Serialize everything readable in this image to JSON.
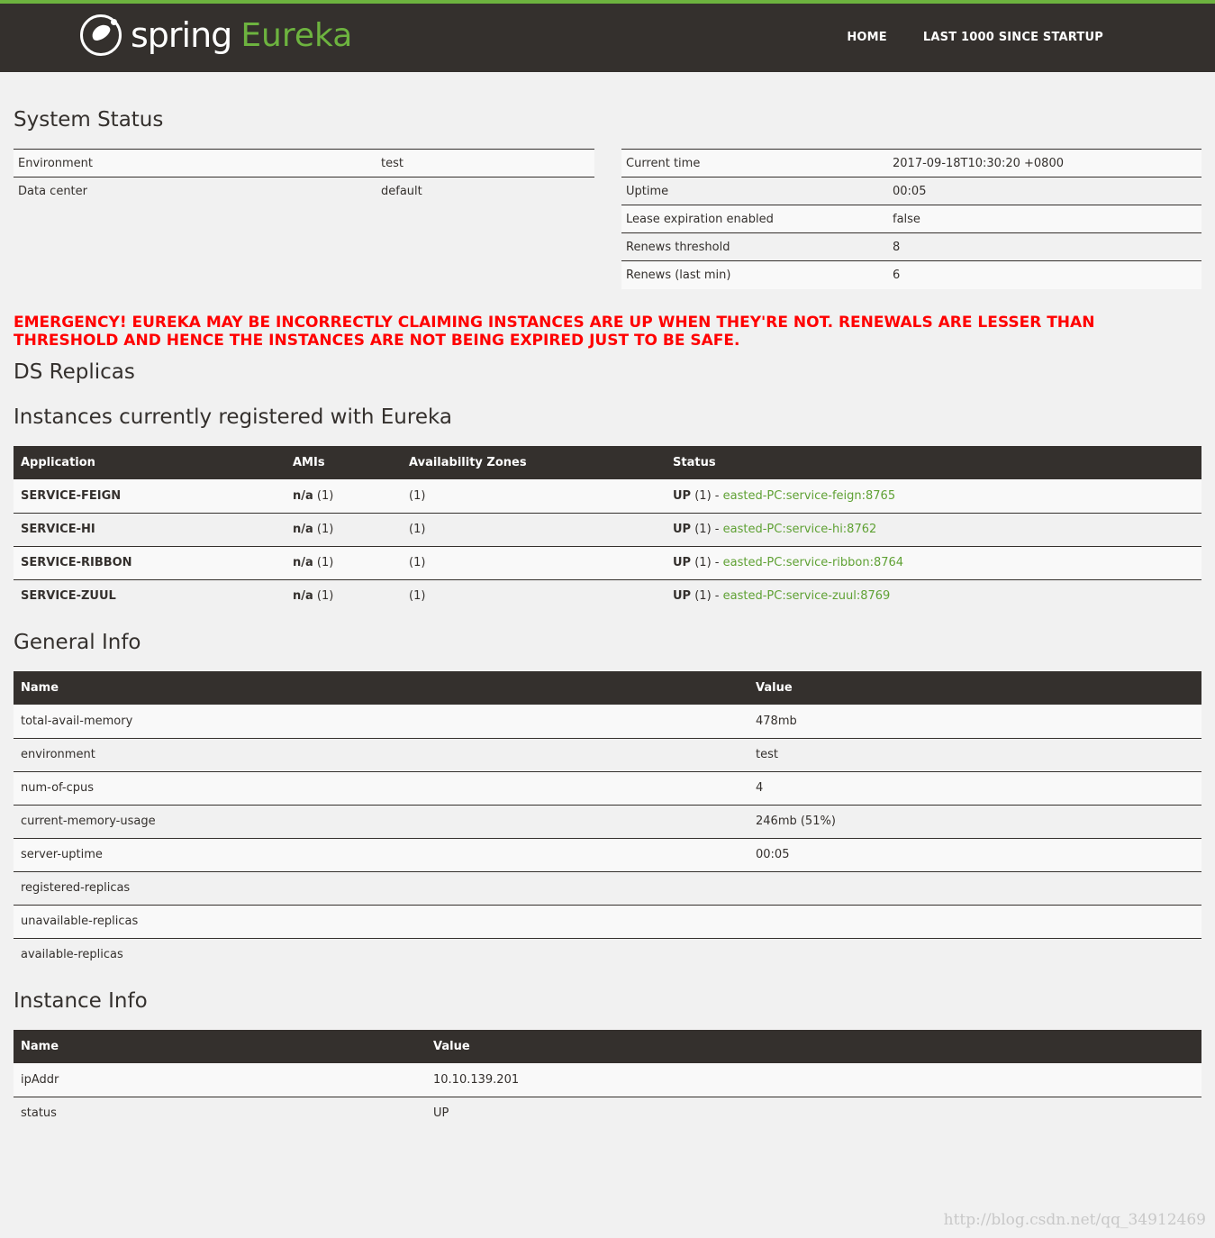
{
  "brand": {
    "spring": "spring",
    "eureka": "Eureka"
  },
  "nav": {
    "home": "HOME",
    "last1000": "LAST 1000 SINCE STARTUP"
  },
  "system_status": {
    "title": "System Status",
    "left": [
      {
        "label": "Environment",
        "value": "test"
      },
      {
        "label": "Data center",
        "value": "default"
      }
    ],
    "right": [
      {
        "label": "Current time",
        "value": "2017-09-18T10:30:20 +0800"
      },
      {
        "label": "Uptime",
        "value": "00:05"
      },
      {
        "label": "Lease expiration enabled",
        "value": "false"
      },
      {
        "label": "Renews threshold",
        "value": "8"
      },
      {
        "label": "Renews (last min)",
        "value": "6"
      }
    ]
  },
  "emergency": "EMERGENCY! EUREKA MAY BE INCORRECTLY CLAIMING INSTANCES ARE UP WHEN THEY'RE NOT. RENEWALS ARE LESSER THAN THRESHOLD AND HENCE THE INSTANCES ARE NOT BEING EXPIRED JUST TO BE SAFE.",
  "ds_replicas": {
    "title": "DS Replicas"
  },
  "instances": {
    "title": "Instances currently registered with Eureka",
    "headers": [
      "Application",
      "AMIs",
      "Availability Zones",
      "Status"
    ],
    "rows": [
      {
        "app": "SERVICE-FEIGN",
        "ami": "n/a",
        "ami_count": "(1)",
        "zones": "(1)",
        "status": "UP",
        "status_count": "(1) -",
        "link": "easted-PC:service-feign:8765"
      },
      {
        "app": "SERVICE-HI",
        "ami": "n/a",
        "ami_count": "(1)",
        "zones": "(1)",
        "status": "UP",
        "status_count": "(1) -",
        "link": "easted-PC:service-hi:8762"
      },
      {
        "app": "SERVICE-RIBBON",
        "ami": "n/a",
        "ami_count": "(1)",
        "zones": "(1)",
        "status": "UP",
        "status_count": "(1) -",
        "link": "easted-PC:service-ribbon:8764"
      },
      {
        "app": "SERVICE-ZUUL",
        "ami": "n/a",
        "ami_count": "(1)",
        "zones": "(1)",
        "status": "UP",
        "status_count": "(1) -",
        "link": "easted-PC:service-zuul:8769"
      }
    ]
  },
  "general_info": {
    "title": "General Info",
    "headers": [
      "Name",
      "Value"
    ],
    "rows": [
      {
        "name": "total-avail-memory",
        "value": "478mb"
      },
      {
        "name": "environment",
        "value": "test"
      },
      {
        "name": "num-of-cpus",
        "value": "4"
      },
      {
        "name": "current-memory-usage",
        "value": "246mb (51%)"
      },
      {
        "name": "server-uptime",
        "value": "00:05"
      },
      {
        "name": "registered-replicas",
        "value": ""
      },
      {
        "name": "unavailable-replicas",
        "value": ""
      },
      {
        "name": "available-replicas",
        "value": ""
      }
    ]
  },
  "instance_info": {
    "title": "Instance Info",
    "headers": [
      "Name",
      "Value"
    ],
    "rows": [
      {
        "name": "ipAddr",
        "value": "10.10.139.201"
      },
      {
        "name": "status",
        "value": "UP"
      }
    ]
  },
  "watermark": "http://blog.csdn.net/qq_34912469",
  "colors": {
    "brand_green": "#6db33f",
    "navbar": "#34302d",
    "emergency_red": "#ff0000"
  }
}
